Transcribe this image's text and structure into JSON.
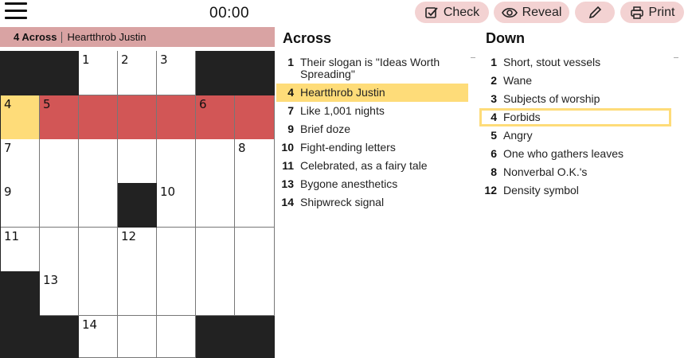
{
  "header": {
    "timer": "00:00",
    "buttons": [
      {
        "label": "Check",
        "icon": "check-square-icon"
      },
      {
        "label": "Reveal",
        "icon": "eye-icon"
      },
      {
        "label": "",
        "icon": "pencil-icon"
      },
      {
        "label": "Print",
        "icon": "printer-icon"
      }
    ]
  },
  "banner": {
    "number": "4 Across",
    "clue": "Heartthrob Justin"
  },
  "grid": {
    "numbers": {
      "n1": "1",
      "n2": "2",
      "n3": "3",
      "n4": "4",
      "n5": "5",
      "n6": "6",
      "n7": "7",
      "n8": "8",
      "n9": "9",
      "n10": "10",
      "n11": "11",
      "n12": "12",
      "n13": "13",
      "n14": "14"
    }
  },
  "across": {
    "title": "Across",
    "clues": [
      {
        "num": "1",
        "text": "Their slogan is \"Ideas Worth Spreading\""
      },
      {
        "num": "4",
        "text": "Heartthrob Justin"
      },
      {
        "num": "7",
        "text": "Like 1,001 nights"
      },
      {
        "num": "9",
        "text": "Brief doze"
      },
      {
        "num": "10",
        "text": "Fight-ending letters"
      },
      {
        "num": "11",
        "text": "Celebrated, as a fairy tale"
      },
      {
        "num": "13",
        "text": "Bygone anesthetics"
      },
      {
        "num": "14",
        "text": "Shipwreck signal"
      }
    ]
  },
  "down": {
    "title": "Down",
    "clues": [
      {
        "num": "1",
        "text": "Short, stout vessels"
      },
      {
        "num": "2",
        "text": "Wane"
      },
      {
        "num": "3",
        "text": "Subjects of worship"
      },
      {
        "num": "4",
        "text": "Forbids"
      },
      {
        "num": "5",
        "text": "Angry"
      },
      {
        "num": "6",
        "text": "One who gathers leaves"
      },
      {
        "num": "8",
        "text": "Nonverbal O.K.'s"
      },
      {
        "num": "12",
        "text": "Density symbol"
      }
    ]
  },
  "colors": {
    "active_cell": "#fedc79",
    "active_word": "#d25656",
    "banner": "#d9a3a3",
    "button_bg": "#f3d2d2",
    "block": "#222222"
  }
}
